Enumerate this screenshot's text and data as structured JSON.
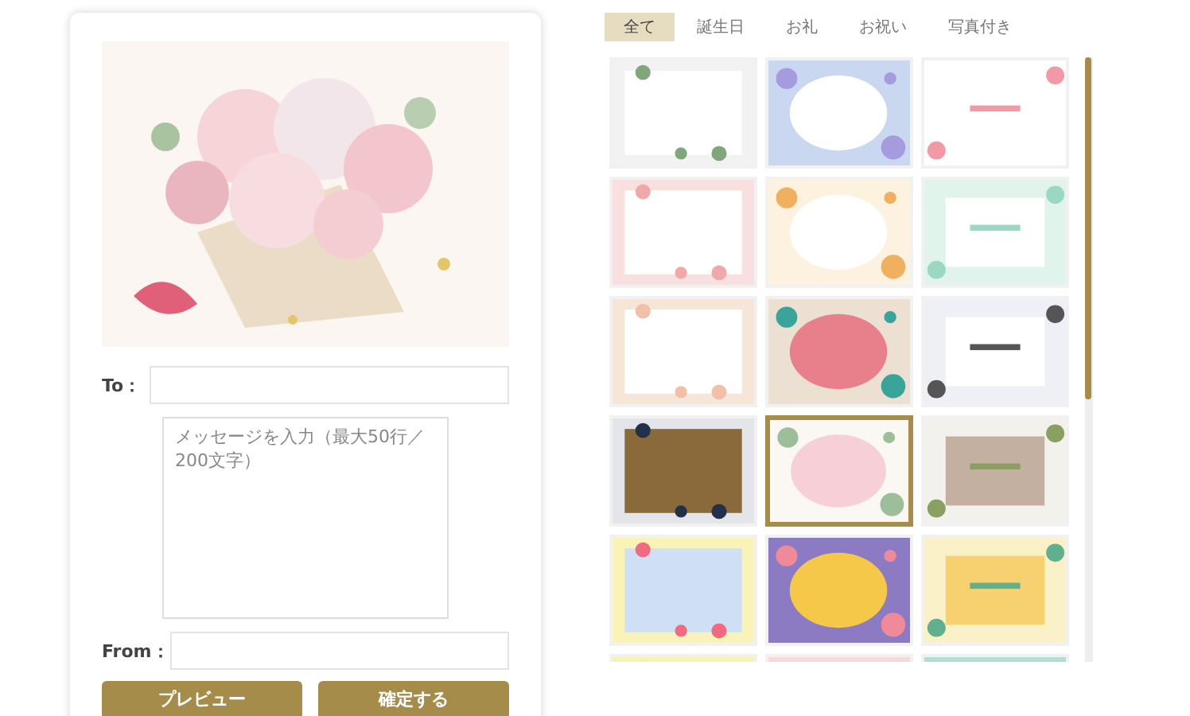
{
  "form": {
    "to_label": "To：",
    "message_placeholder": "メッセージを入力（最大50行／200文字）",
    "from_label": "From："
  },
  "buttons": [
    {
      "label": "プレビュー"
    },
    {
      "label": "確定する"
    }
  ],
  "tabs": [
    {
      "label": "全て",
      "selected": true
    },
    {
      "label": "誕生日",
      "selected": false
    },
    {
      "label": "お礼",
      "selected": false
    },
    {
      "label": "お祝い",
      "selected": false
    },
    {
      "label": "写真付き",
      "selected": false
    }
  ],
  "cards": [
    {
      "selected": false
    },
    {
      "selected": false
    },
    {
      "selected": false
    },
    {
      "selected": false
    },
    {
      "selected": false
    },
    {
      "selected": false
    },
    {
      "selected": false
    },
    {
      "selected": false
    },
    {
      "selected": false
    },
    {
      "selected": false
    },
    {
      "selected": true
    },
    {
      "selected": false
    },
    {
      "selected": false
    },
    {
      "selected": false
    },
    {
      "selected": false
    },
    {
      "selected": false
    },
    {
      "selected": false
    },
    {
      "selected": false
    }
  ]
}
